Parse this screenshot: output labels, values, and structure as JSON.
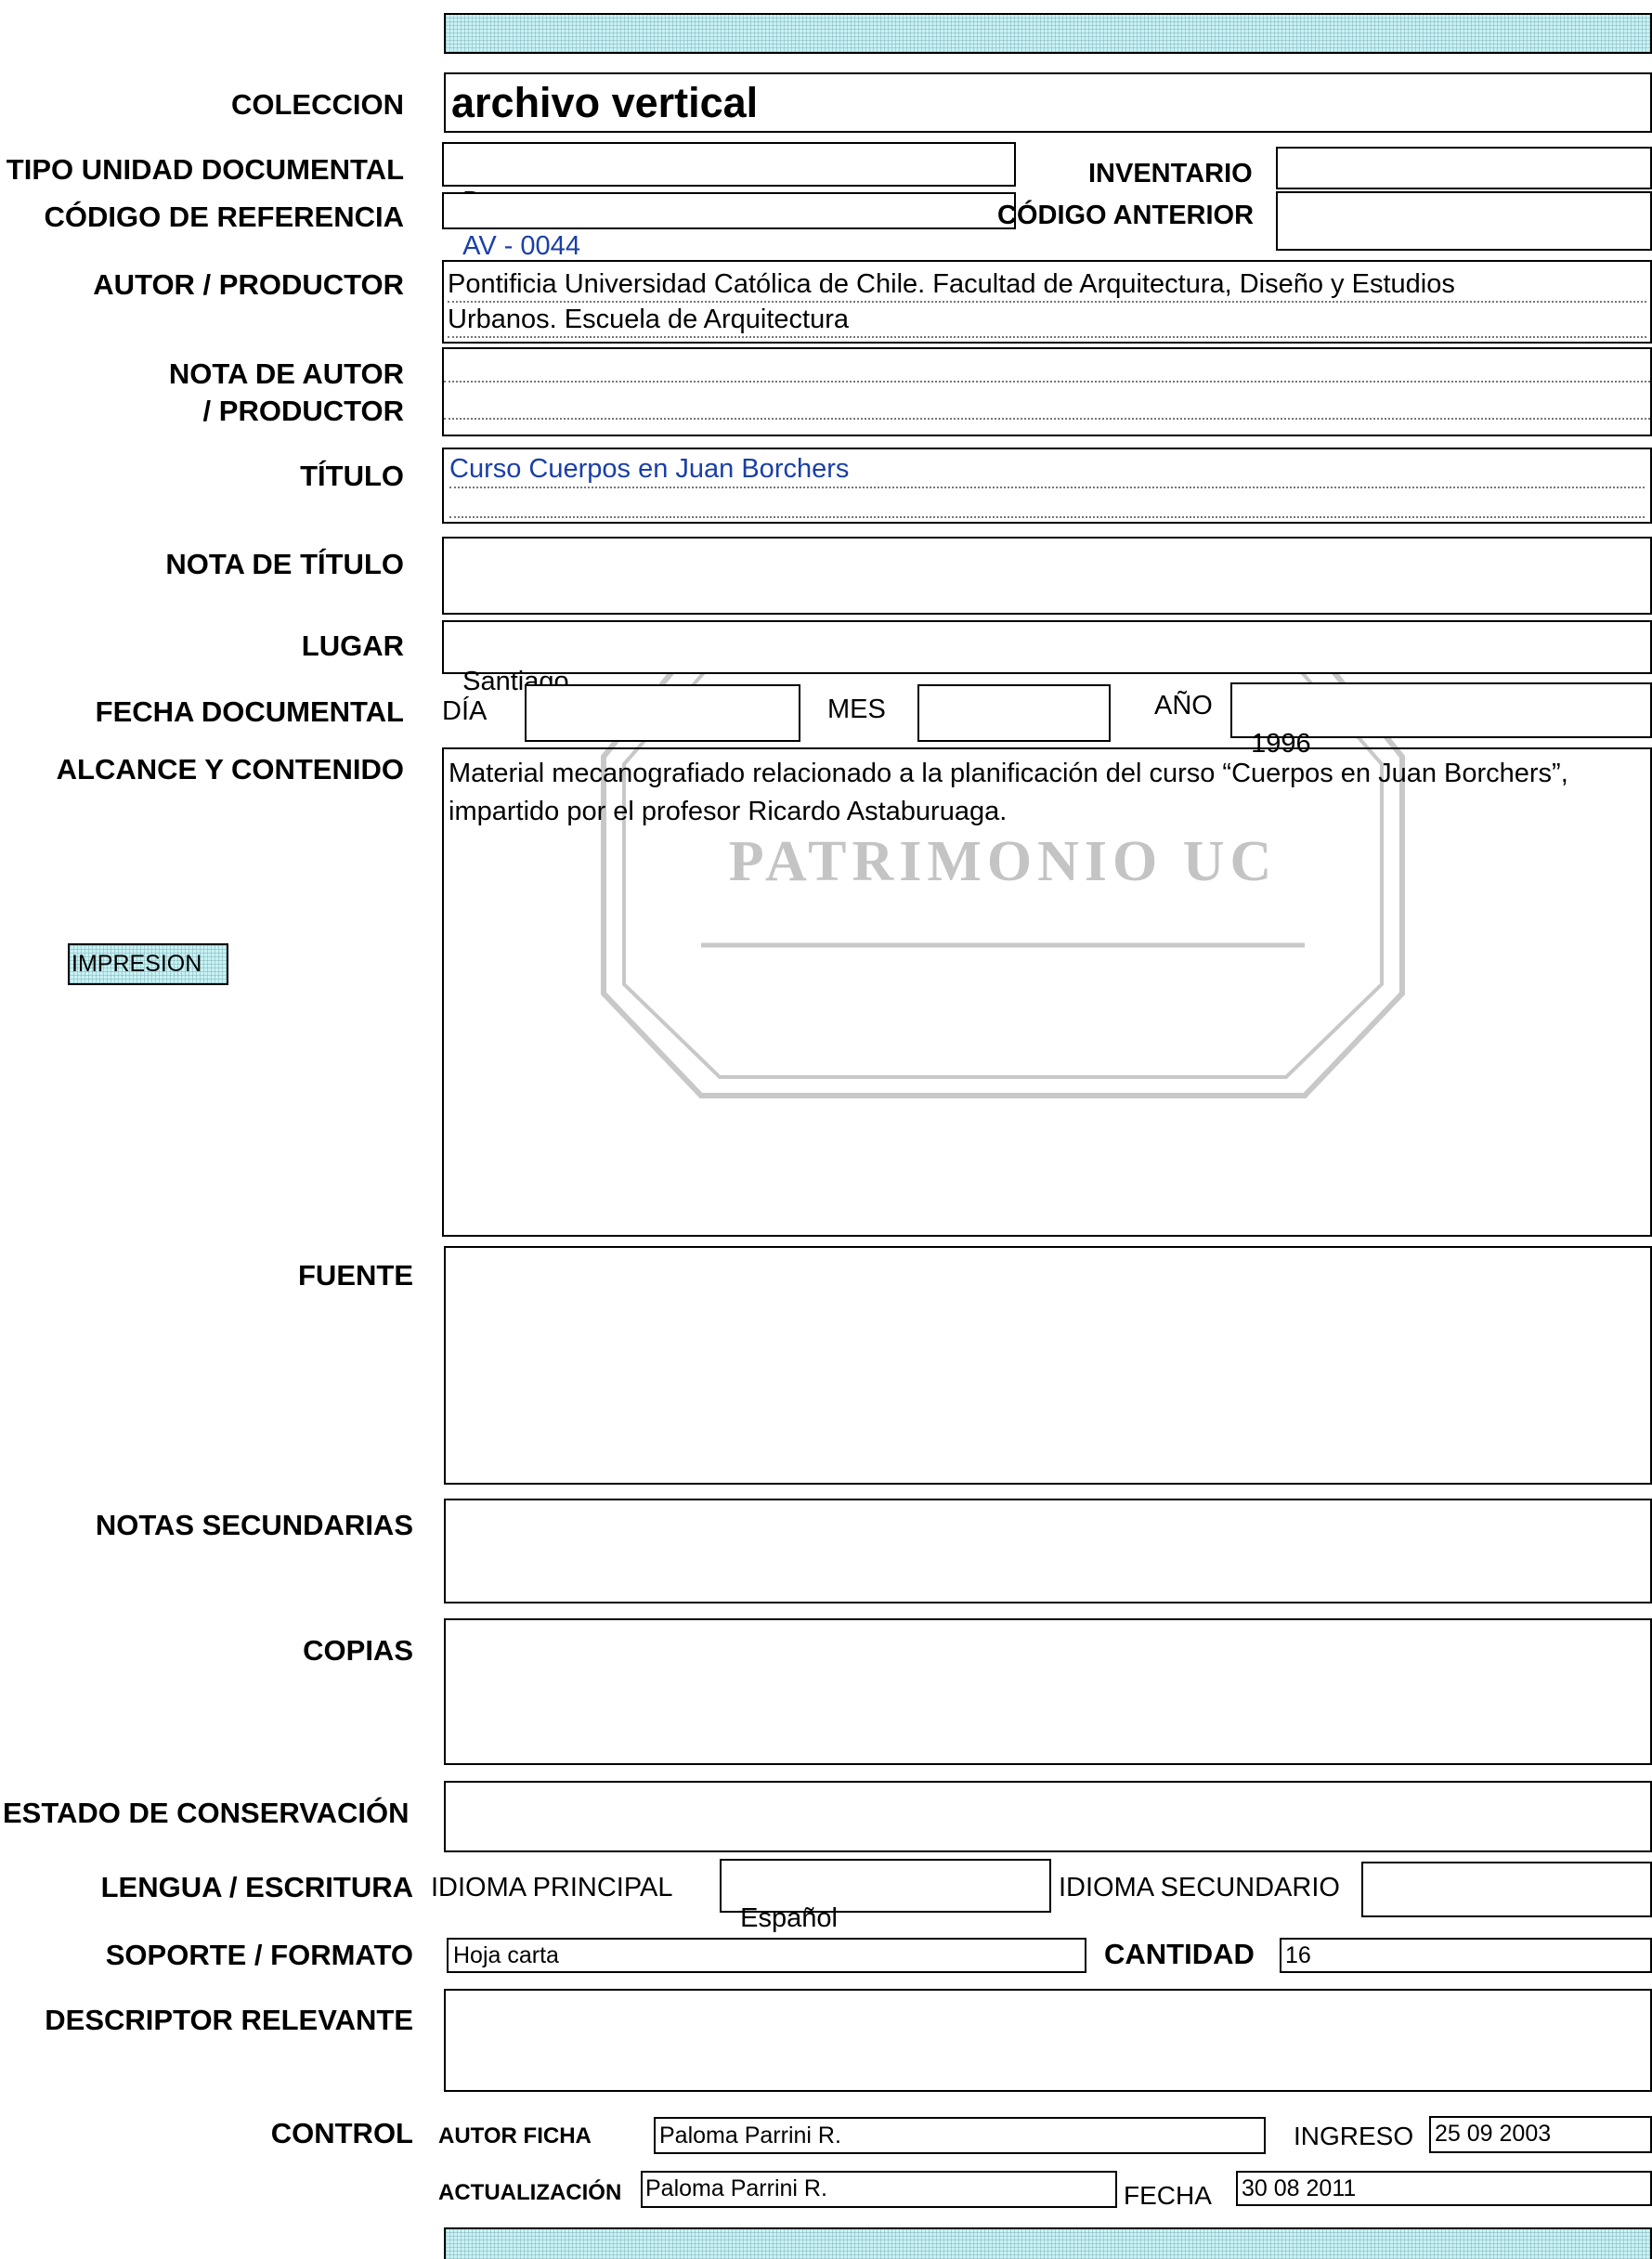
{
  "fields": {
    "coleccion": {
      "label": "COLECCION",
      "value": "archivo vertical"
    },
    "tipo_unidad": {
      "label": "TIPO UNIDAD DOCUMENTAL",
      "value": "Documento"
    },
    "inventario": {
      "label": "INVENTARIO",
      "value": ""
    },
    "codigo_referencia": {
      "label": "CÓDIGO DE REFERENCIA",
      "value": "AV - 0044"
    },
    "codigo_anterior": {
      "label": "CÓDIGO ANTERIOR",
      "value": ""
    },
    "autor": {
      "label": "AUTOR / PRODUCTOR",
      "value_line1": "Pontificia Universidad Católica de Chile. Facultad de Arquitectura, Diseño y Estudios",
      "value_line2": "Urbanos. Escuela de Arquitectura"
    },
    "nota_autor": {
      "label_line1": "NOTA DE AUTOR",
      "label_line2": "/ PRODUCTOR",
      "value": ""
    },
    "titulo": {
      "label": "TÍTULO",
      "value": "Curso Cuerpos en Juan Borchers"
    },
    "nota_titulo": {
      "label": "NOTA DE TÍTULO",
      "value": ""
    },
    "lugar": {
      "label": "LUGAR",
      "value": "Santiago"
    },
    "fecha": {
      "label": "FECHA DOCUMENTAL",
      "dia_label": "DÍA",
      "dia": "",
      "mes_label": "MES",
      "mes": "",
      "anio_label": "AÑO",
      "anio": "1996"
    },
    "alcance": {
      "label": "ALCANCE Y CONTENIDO",
      "value": "Material mecanografiado relacionado a la planificación del curso “Cuerpos en Juan Borchers”, impartido por el profesor Ricardo Astaburuaga."
    },
    "fuente": {
      "label": "FUENTE",
      "value": ""
    },
    "notas_secundarias": {
      "label": "NOTAS SECUNDARIAS",
      "value": ""
    },
    "copias": {
      "label": "COPIAS",
      "value": ""
    },
    "estado": {
      "label": "ESTADO DE CONSERVACIÓN",
      "value": ""
    },
    "lengua": {
      "label": "LENGUA / ESCRITURA",
      "principal_label": "IDIOMA PRINCIPAL",
      "principal": "Español",
      "secundario_label": "IDIOMA SECUNDARIO",
      "secundario": ""
    },
    "soporte": {
      "label": "SOPORTE / FORMATO",
      "value": "Hoja carta",
      "cantidad_label": "CANTIDAD",
      "cantidad": "16"
    },
    "descriptor": {
      "label": "DESCRIPTOR RELEVANTE",
      "value": ""
    },
    "control": {
      "label": "CONTROL",
      "autor_ficha_label": "AUTOR FICHA",
      "autor_ficha": "Paloma Parrini R.",
      "ingreso_label": "INGRESO",
      "ingreso": "25 09 2003",
      "actualizacion_label": "ACTUALIZACIÓN",
      "actualizacion": "Paloma Parrini R.",
      "fecha_label": "FECHA",
      "fecha": "30 08 2011"
    }
  },
  "buttons": {
    "impresion": "IMPRESION"
  },
  "watermark": {
    "text": "PATRIMONIO UC"
  },
  "colors": {
    "link": "#1a3fa8",
    "hatch": "#c8f2f5"
  }
}
